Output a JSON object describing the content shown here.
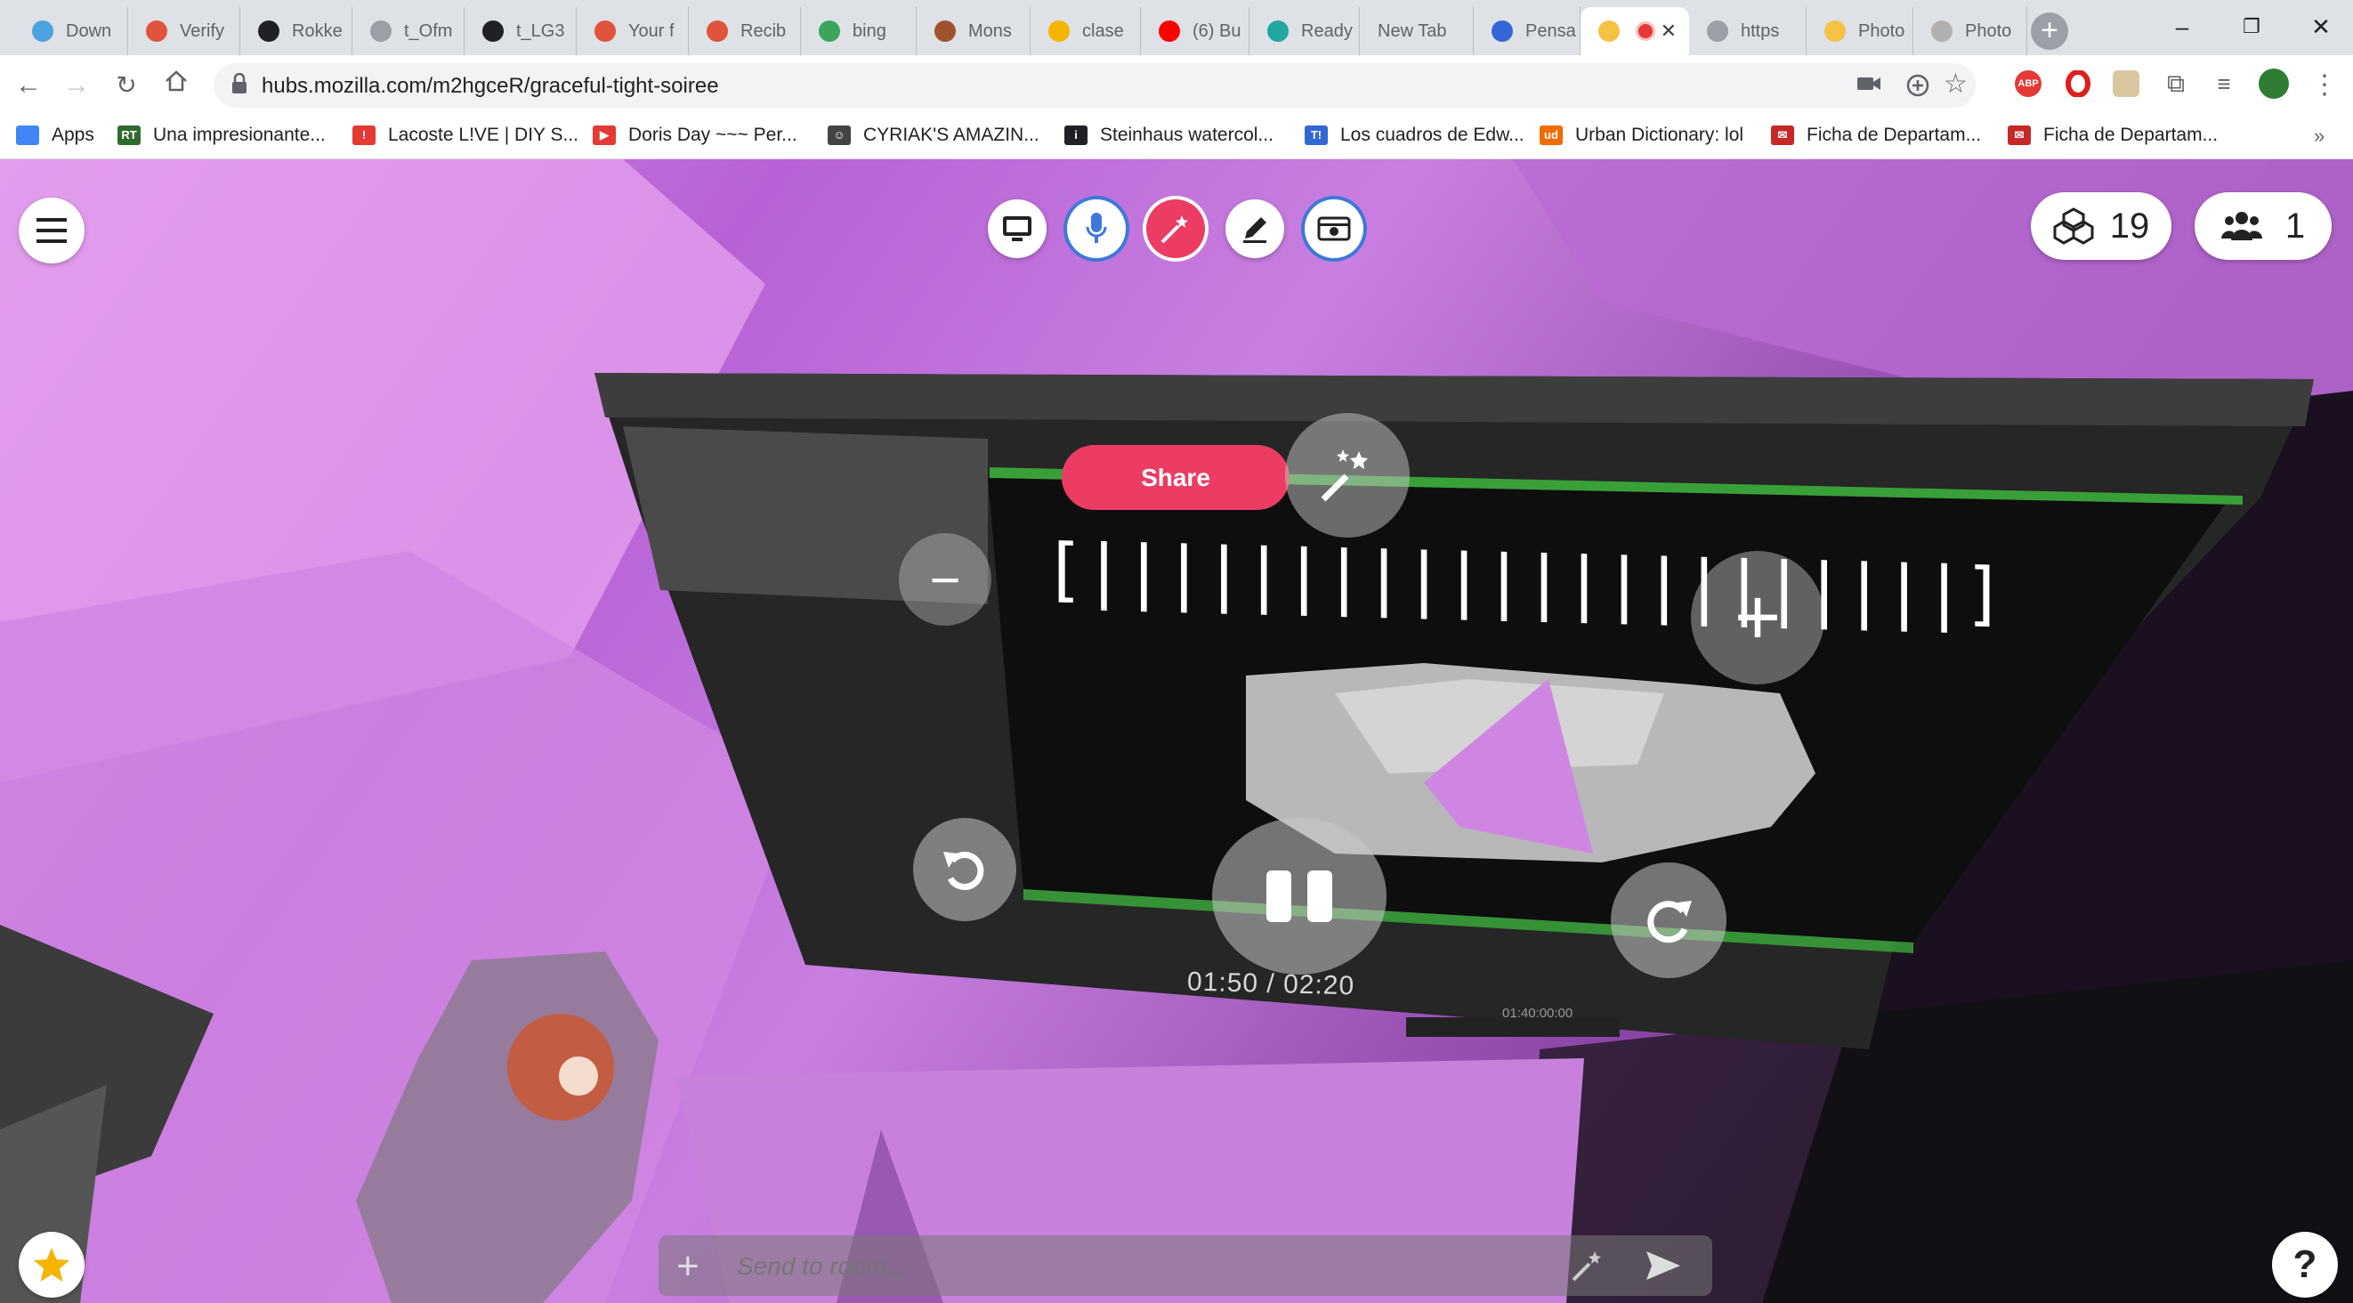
{
  "browser": {
    "tabs": [
      {
        "title": "Down",
        "color": "#4aa3df"
      },
      {
        "title": "Verify",
        "color": "#e0533d"
      },
      {
        "title": "Rokke",
        "color": "#202124"
      },
      {
        "title": "t_Ofm",
        "color": "#9aa0a6"
      },
      {
        "title": "t_LG3",
        "color": "#202124"
      },
      {
        "title": "Your f",
        "color": "#e0533d"
      },
      {
        "title": "Recib",
        "color": "#e0533d"
      },
      {
        "title": "bing",
        "color": "#3ba55c"
      },
      {
        "title": "Mons",
        "color": "#a0522d"
      },
      {
        "title": "clase",
        "color": "#f4b400"
      },
      {
        "title": "(6) Bu",
        "color": "#ff0000"
      },
      {
        "title": "Ready",
        "color": "#22a6a0"
      },
      {
        "title": "New Tab",
        "color": ""
      },
      {
        "title": "Pensa",
        "color": "#3367d6"
      },
      {
        "title": "",
        "color": "#f6c244"
      },
      {
        "title": "https",
        "color": "#9aa0a6"
      },
      {
        "title": "Photo",
        "color": "#f6c244"
      },
      {
        "title": "Photo",
        "color": "#b0b0b0"
      }
    ],
    "new_tab_icon": "+",
    "window_controls": {
      "minimize": "–",
      "restore": "❐",
      "close": "✕"
    },
    "url": "hubs.mozilla.com/m2hgceR/graceful-tight-soiree",
    "bookmarks": [
      {
        "label": "Apps",
        "icon_color": "#4285f4",
        "icon_text": ""
      },
      {
        "label": "Una impresionante...",
        "icon_color": "#2f6b2f",
        "icon_text": "RT"
      },
      {
        "label": "Lacoste L!VE | DIY S...",
        "icon_color": "#e53935",
        "icon_text": "!"
      },
      {
        "label": "Doris Day ~~~ Per...",
        "icon_color": "#e53935",
        "icon_text": "▶"
      },
      {
        "label": "CYRIAK'S AMAZIN...",
        "icon_color": "#444444",
        "icon_text": "☺"
      },
      {
        "label": "Steinhaus watercol...",
        "icon_color": "#202124",
        "icon_text": "i"
      },
      {
        "label": "Los cuadros de Edw...",
        "icon_color": "#3367d6",
        "icon_text": "T!"
      },
      {
        "label": "Urban Dictionary: lol",
        "icon_color": "#ef6c00",
        "icon_text": "ud"
      },
      {
        "label": "Ficha de Departam...",
        "icon_color": "#c62828",
        "icon_text": "✉"
      },
      {
        "label": "Ficha de Departam...",
        "icon_color": "#c62828",
        "icon_text": "✉"
      }
    ]
  },
  "hubs": {
    "toolbar_icons": [
      "screen-share-icon",
      "microphone-icon",
      "magic-wand-icon",
      "pen-icon",
      "camera-icon"
    ],
    "share_label": "Share",
    "objects_count": "19",
    "people_count": "1",
    "media_player": {
      "title_text": "[||||||||||||||||||||||]",
      "time": "01:50 / 02:20",
      "zoom_out": "−",
      "zoom_in": "+",
      "tc": "01:40:00:00"
    },
    "chat_placeholder": "Send to room...",
    "help_label": "?"
  }
}
